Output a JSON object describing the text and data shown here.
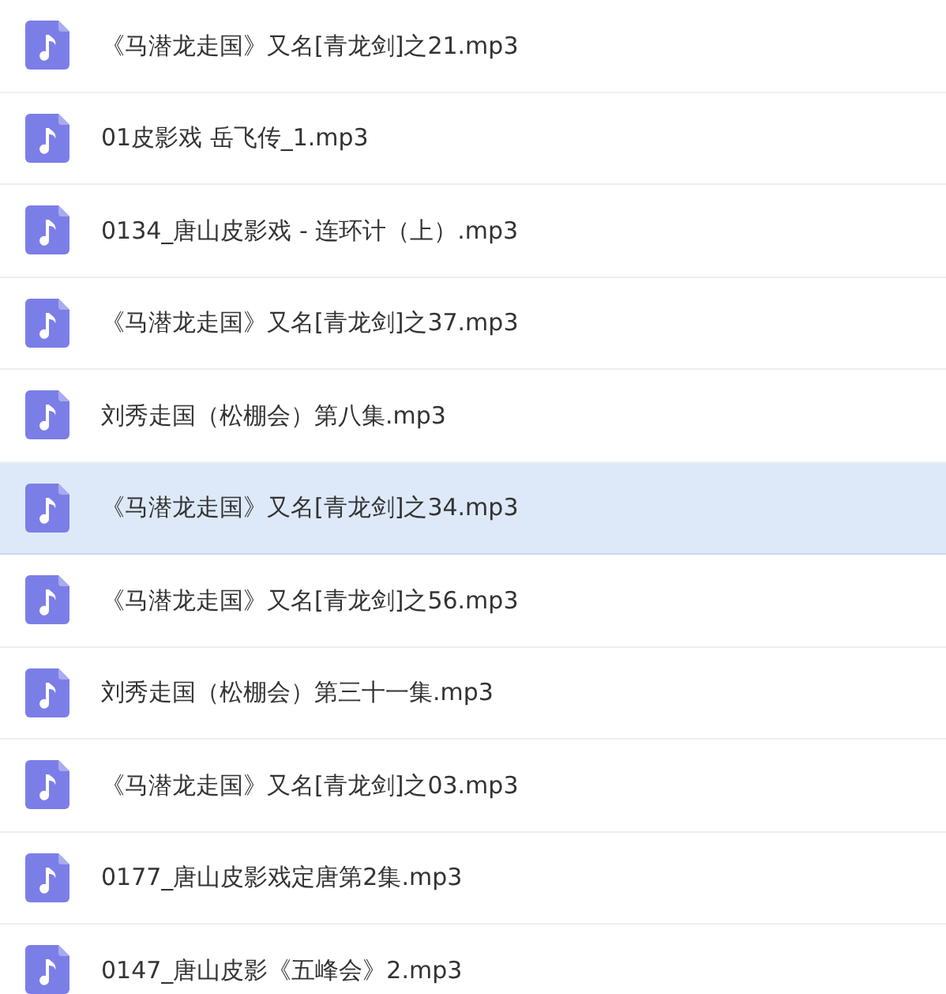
{
  "files": [
    {
      "name": "《马潜龙走国》又名[青龙剑]之21.mp3",
      "selected": false
    },
    {
      "name": "01皮影戏 岳飞传_1.mp3",
      "selected": false
    },
    {
      "name": "0134_唐山皮影戏 - 连环计（上）.mp3",
      "selected": false
    },
    {
      "name": "《马潜龙走国》又名[青龙剑]之37.mp3",
      "selected": false
    },
    {
      "name": "刘秀走国（松棚会）第八集.mp3",
      "selected": false
    },
    {
      "name": "《马潜龙走国》又名[青龙剑]之34.mp3",
      "selected": true
    },
    {
      "name": "《马潜龙走国》又名[青龙剑]之56.mp3",
      "selected": false
    },
    {
      "name": "刘秀走国（松棚会）第三十一集.mp3",
      "selected": false
    },
    {
      "name": "《马潜龙走国》又名[青龙剑]之03.mp3",
      "selected": false
    },
    {
      "name": "0177_唐山皮影戏定唐第2集.mp3",
      "selected": false
    },
    {
      "name": "0147_唐山皮影《五峰会》2.mp3",
      "selected": false
    }
  ]
}
